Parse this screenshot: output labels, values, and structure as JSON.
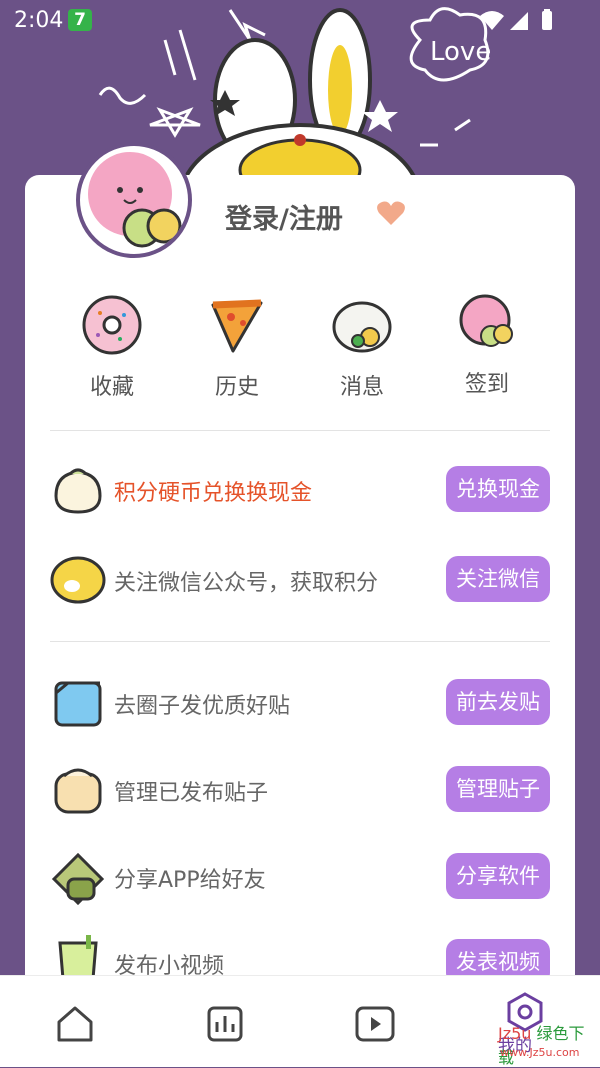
{
  "status_bar": {
    "time": "2:04",
    "app_badge": "7"
  },
  "user": {
    "login_text": "登录/注册"
  },
  "quick_actions": [
    {
      "label": "收藏",
      "icon": "donut-icon"
    },
    {
      "label": "历史",
      "icon": "pizza-icon"
    },
    {
      "label": "消息",
      "icon": "rice-ball-icon"
    },
    {
      "label": "签到",
      "icon": "macaron-icon"
    }
  ],
  "tasks": [
    {
      "text": "积分硬币兑换换现金",
      "button": "兑换现金",
      "icon": "bun-icon",
      "highlight": true
    },
    {
      "text": "关注微信公众号，获取积分",
      "button": "关注微信",
      "icon": "lemon-icon"
    },
    {
      "text": "去圈子发优质好贴",
      "button": "前去发贴",
      "icon": "ice-cube-icon"
    },
    {
      "text": "管理已发布贴子",
      "button": "管理贴子",
      "icon": "dumpling-icon"
    },
    {
      "text": "分享APP给好友",
      "button": "分享软件",
      "icon": "toast-icon"
    },
    {
      "text": "发布小视频",
      "button": "发表视频",
      "icon": "drink-icon"
    }
  ],
  "nav": {
    "items": [
      {
        "name": "home",
        "icon": "home-icon"
      },
      {
        "name": "stats",
        "icon": "chart-icon"
      },
      {
        "name": "video",
        "icon": "play-icon"
      },
      {
        "name": "mine",
        "icon": "profile-hexagon-icon",
        "label": "我的"
      }
    ],
    "active": "mine"
  },
  "watermark": {
    "part1": "Jz5u",
    "part2": "绿色下载",
    "url": "www.Jz5u.com"
  },
  "colors": {
    "background": "#6b5287",
    "accent": "#b57ee5",
    "highlight": "#e5532a"
  }
}
